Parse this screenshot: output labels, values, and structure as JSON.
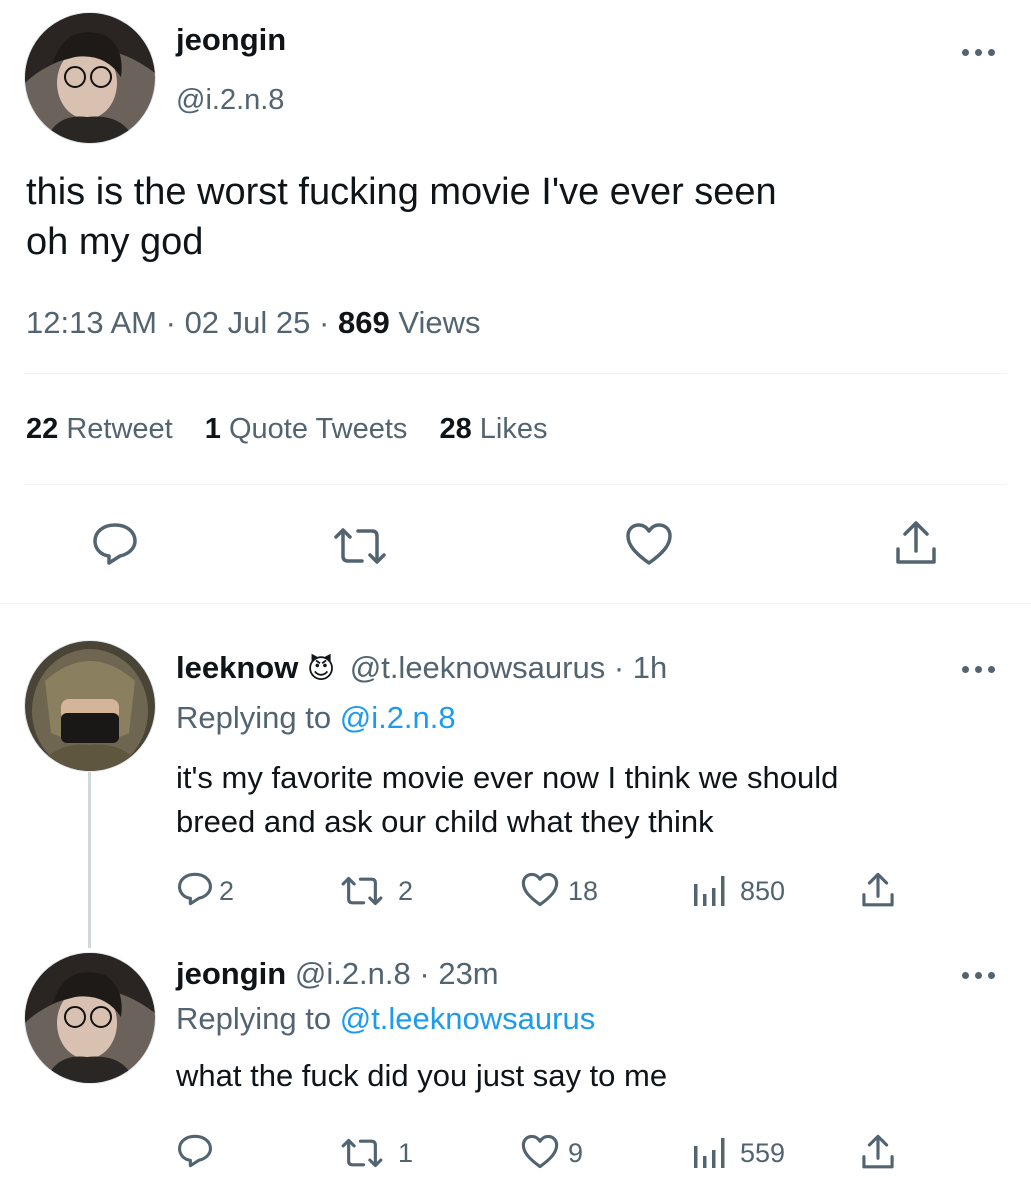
{
  "main_tweet": {
    "display_name": "jeongin",
    "handle": "@i.2.n.8",
    "text_line1": "this is the worst fucking movie I've ever seen",
    "text_line2": "oh my god",
    "time": "12:13 AM",
    "date": "02 Jul 25",
    "separator": "·",
    "views_count": "869",
    "views_label": "Views",
    "retweets_count": "22",
    "retweets_label": "Retweet",
    "quotes_count": "1",
    "quotes_label": "Quote Tweets",
    "likes_count": "28",
    "likes_label": "Likes"
  },
  "reply1": {
    "display_name": "leeknow",
    "emoji": "😈",
    "handle": "@t.leeknowsaurus",
    "age": "· 1h",
    "replying_prefix": "Replying to",
    "replying_handle": "@i.2.n.8",
    "text_line1": "it's my favorite movie ever now I think we should",
    "text_line2": "breed and ask our child what they think",
    "replies": "2",
    "retweets": "2",
    "likes": "18",
    "views": "850"
  },
  "reply2": {
    "display_name": "jeongin",
    "handle": "@i.2.n.8",
    "age": "· 23m",
    "replying_prefix": "Replying to",
    "replying_handle": "@t.leeknowsaurus",
    "text_line1": "what the fuck did you just say to me",
    "retweets": "1",
    "likes": "9",
    "views": "559"
  },
  "icons": {
    "reply": "reply-icon",
    "retweet": "retweet-icon",
    "like": "heart-icon",
    "share": "share-icon",
    "views": "views-icon",
    "more": "more-icon"
  },
  "colors": {
    "text": "#0f1419",
    "secondary": "#536471",
    "link": "#1d9bf0",
    "divider": "#eff3f4"
  }
}
